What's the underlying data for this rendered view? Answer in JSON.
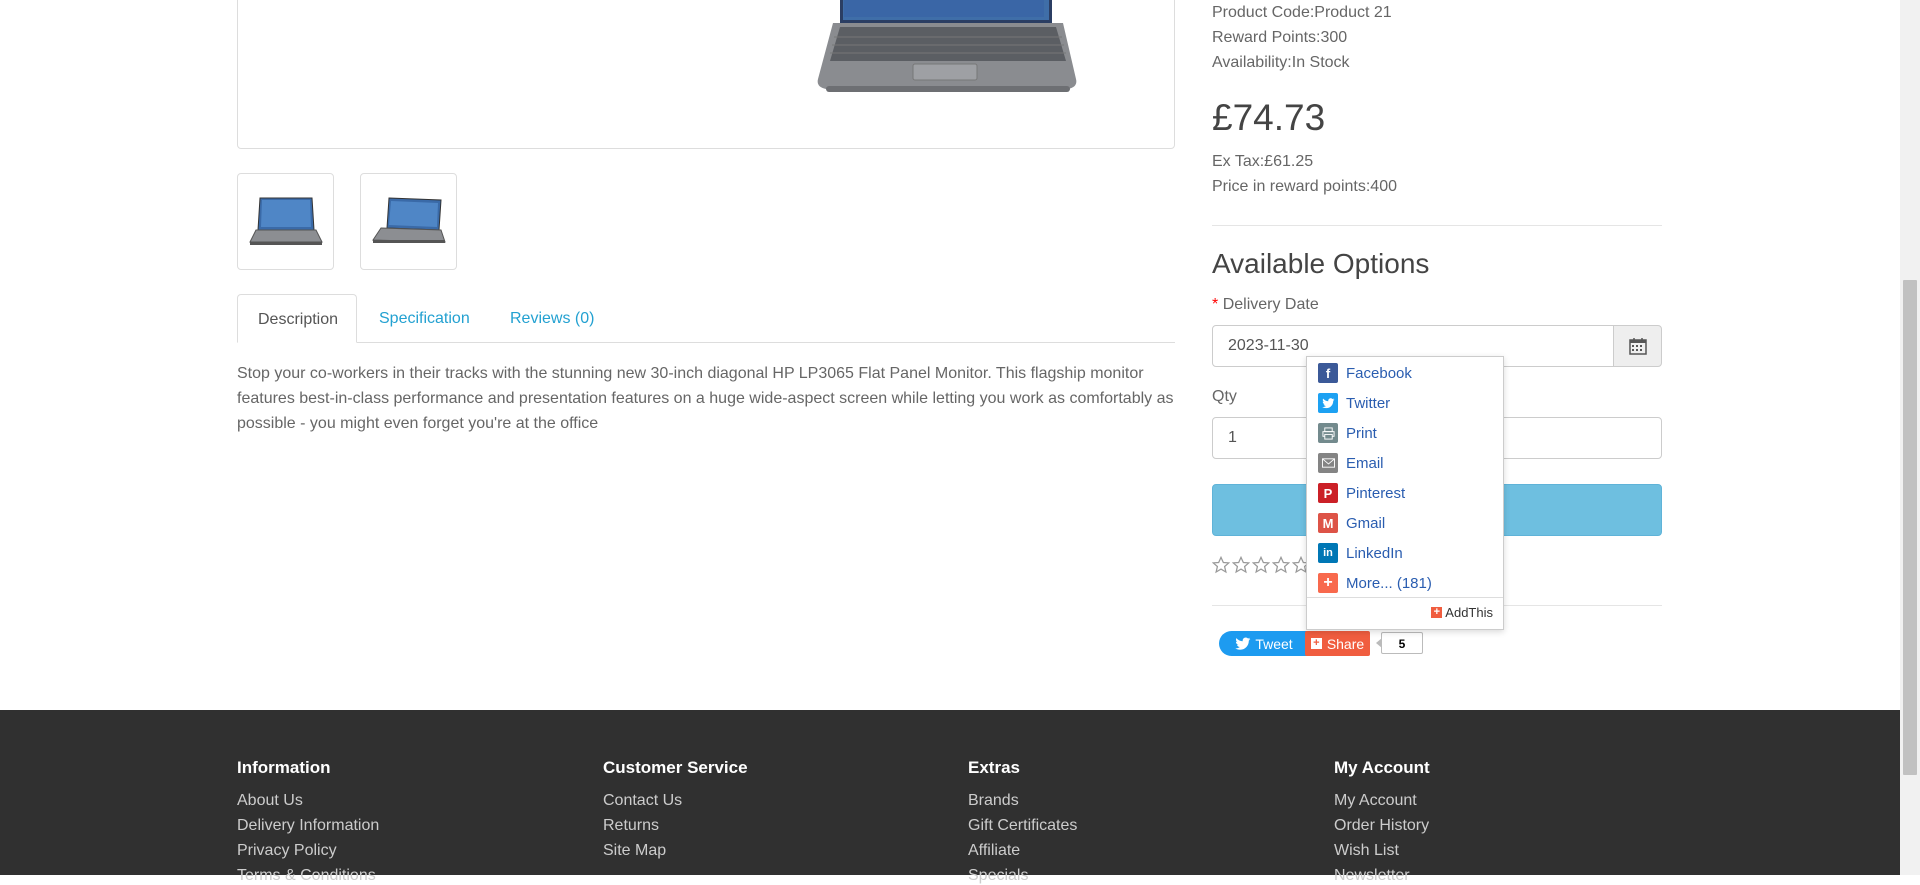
{
  "product": {
    "code_label": "Product Code:",
    "code": "Product 21",
    "reward_label": "Reward Points:",
    "reward": "300",
    "availability_label": "Availability:",
    "availability": "In Stock",
    "price": "£74.73",
    "ex_tax_label": "Ex Tax:",
    "ex_tax": "£61.25",
    "reward_price_label": "Price in reward points:",
    "reward_price": "400"
  },
  "tabs": [
    {
      "label": "Description"
    },
    {
      "label": "Specification"
    },
    {
      "label": "Reviews (0)"
    }
  ],
  "description": "Stop your co-workers in their tracks with the stunning new 30-inch diagonal HP LP3065 Flat Panel Monitor. This flagship monitor features best-in-class performance and presentation features on a huge wide-aspect screen while letting you work as comfortably as possible - you might even forget you're at the office",
  "options": {
    "heading": "Available Options",
    "required_mark": "*",
    "delivery_label": "Delivery Date",
    "delivery_value": "2023-11-30",
    "qty_label": "Qty",
    "qty_value": "1"
  },
  "rating": {
    "stars": 5,
    "filled": 0
  },
  "share_menu": {
    "items": [
      {
        "label": "Facebook",
        "icon": "facebook-icon",
        "color": "#3b5998"
      },
      {
        "label": "Twitter",
        "icon": "twitter-icon",
        "color": "#1da1f2"
      },
      {
        "label": "Print",
        "icon": "print-icon",
        "color": "#738a8d"
      },
      {
        "label": "Email",
        "icon": "email-icon",
        "color": "#848484"
      },
      {
        "label": "Pinterest",
        "icon": "pinterest-icon",
        "color": "#cb2027"
      },
      {
        "label": "Gmail",
        "icon": "gmail-icon",
        "color": "#dd5347"
      },
      {
        "label": "LinkedIn",
        "icon": "linkedin-icon",
        "color": "#0077b5"
      },
      {
        "label": "More... (181)",
        "icon": "plus-icon",
        "color": "#f8694d"
      }
    ],
    "brand": "AddThis"
  },
  "social": {
    "tweet_label": "Tweet",
    "share_label": "Share",
    "share_count": "5"
  },
  "footer": {
    "columns": [
      {
        "heading": "Information",
        "links": [
          "About Us",
          "Delivery Information",
          "Privacy Policy",
          "Terms & Conditions"
        ]
      },
      {
        "heading": "Customer Service",
        "links": [
          "Contact Us",
          "Returns",
          "Site Map"
        ]
      },
      {
        "heading": "Extras",
        "links": [
          "Brands",
          "Gift Certificates",
          "Affiliate",
          "Specials"
        ]
      },
      {
        "heading": "My Account",
        "links": [
          "My Account",
          "Order History",
          "Wish List",
          "Newsletter"
        ]
      }
    ]
  }
}
